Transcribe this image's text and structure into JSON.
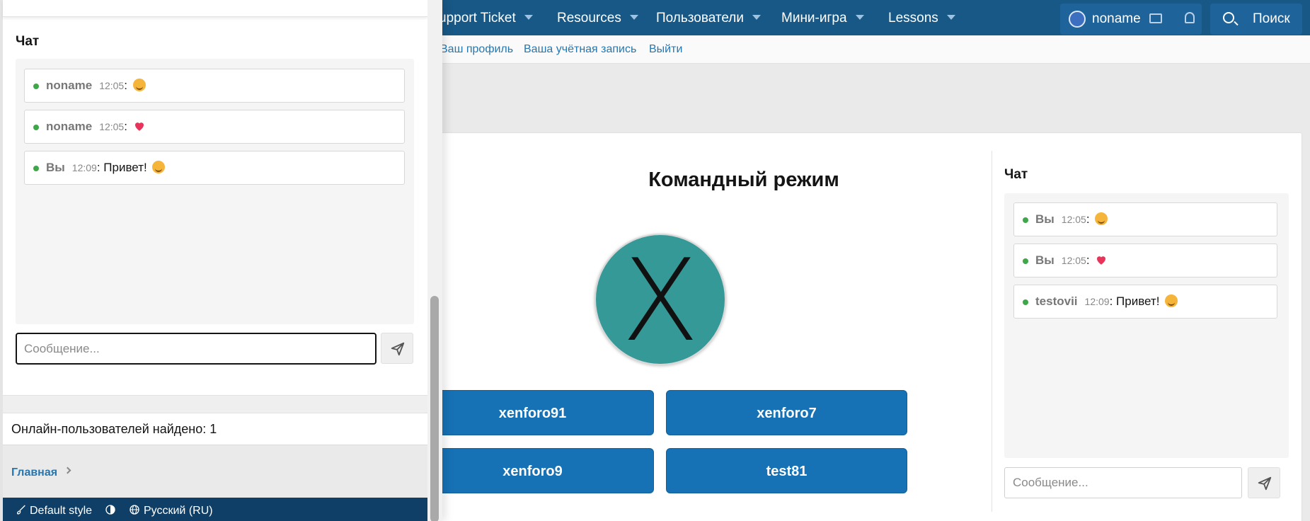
{
  "top_nav": {
    "items": [
      {
        "label": "upport Ticket"
      },
      {
        "label": "Resources"
      },
      {
        "label": "Пользователи"
      },
      {
        "label": "Мини-игра"
      },
      {
        "label": "Lessons"
      }
    ],
    "username": "noname",
    "search_label": "Поиск"
  },
  "sub_nav": {
    "links": [
      "Ваш профиль",
      "Ваша учётная запись",
      "Выйти"
    ]
  },
  "game": {
    "title": "Командный режим",
    "board_symbol": "X",
    "players": [
      "xenforo91",
      "xenforo7",
      "xenforo9",
      "test81"
    ]
  },
  "right_chat": {
    "title": "Чат",
    "messages": [
      {
        "who": "Вы",
        "time": "12:05",
        "text": "",
        "emoji": "smile"
      },
      {
        "who": "Вы",
        "time": "12:05",
        "text": "",
        "emoji": "heart"
      },
      {
        "who": "testovii",
        "time": "12:09",
        "text": "Привет!",
        "emoji": "smile"
      }
    ],
    "input_placeholder": "Сообщение..."
  },
  "left_chat": {
    "title": "Чат",
    "messages": [
      {
        "who": "noname",
        "time": "12:05",
        "text": "",
        "emoji": "smile"
      },
      {
        "who": "noname",
        "time": "12:05",
        "text": "",
        "emoji": "heart"
      },
      {
        "who": "Вы",
        "time": "12:09",
        "text": "Привет!",
        "emoji": "smile"
      }
    ],
    "input_placeholder": "Сообщение..."
  },
  "online": {
    "text": "Онлайн-пользователей найдено: 1"
  },
  "breadcrumb": {
    "home": "Главная"
  },
  "footer": {
    "style_label": "Default style",
    "language_label": "Русский (RU)"
  },
  "colors": {
    "nav_bg": "#185886",
    "button_bg": "#1671b5",
    "board_bg": "#359998",
    "online_dot": "#3fa649",
    "footer_bg": "#0f3f66"
  }
}
